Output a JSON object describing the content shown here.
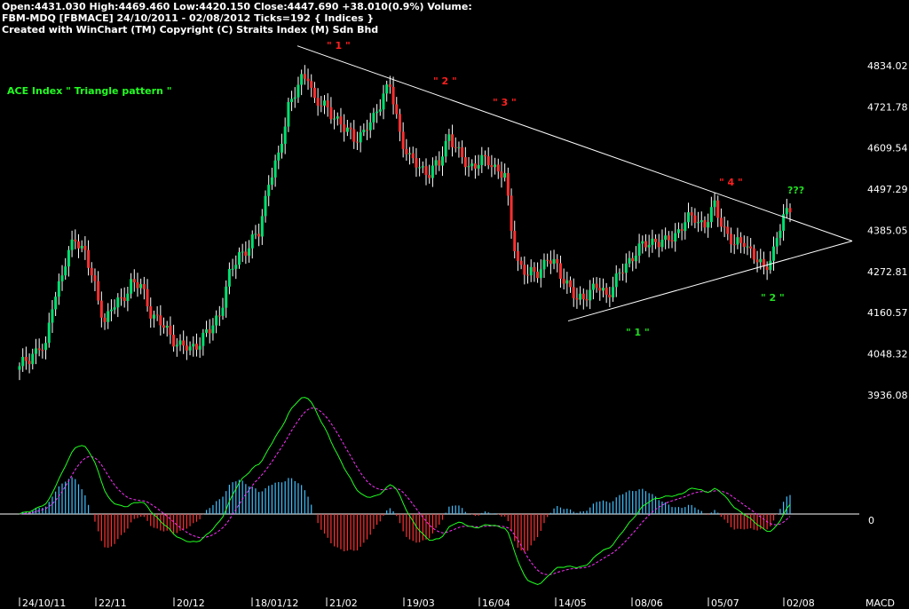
{
  "header": {
    "line1": "Open:4431.030  High:4469.460  Low:4420.150  Close:4447.690  +38.010(0.9%)  Volume:",
    "line2": "FBM-MDQ [FBMACE]  24/10/2011 - 02/08/2012  Ticks=192  { Indices }",
    "line3": "Created with WinChart (TM)  Copyright (C) Straits Index (M) Sdn Bhd"
  },
  "chart_data": {
    "type": "candlestick",
    "title": "ACE Index  \" Triangle pattern \"",
    "ylim": [
      3936.08,
      4834.02
    ],
    "y_ticks": [
      4834.02,
      4721.78,
      4609.54,
      4497.29,
      4385.05,
      4272.81,
      4160.57,
      4048.32,
      3936.08
    ],
    "x_ticks": [
      "24/10/11",
      "22/11",
      "20/12",
      "18/01/12",
      "21/02",
      "19/03",
      "16/04",
      "14/05",
      "08/06",
      "05/07",
      "02/08"
    ],
    "close_path": [
      [
        0,
        4015
      ],
      [
        3,
        4030
      ],
      [
        6,
        4075
      ],
      [
        8,
        4060
      ],
      [
        10,
        4180
      ],
      [
        14,
        4300
      ],
      [
        17,
        4360
      ],
      [
        20,
        4330
      ],
      [
        24,
        4190
      ],
      [
        26,
        4140
      ],
      [
        28,
        4175
      ],
      [
        31,
        4190
      ],
      [
        34,
        4245
      ],
      [
        37,
        4230
      ],
      [
        40,
        4165
      ],
      [
        43,
        4130
      ],
      [
        46,
        4100
      ],
      [
        49,
        4070
      ],
      [
        52,
        4060
      ],
      [
        55,
        4085
      ],
      [
        58,
        4110
      ],
      [
        61,
        4160
      ],
      [
        64,
        4260
      ],
      [
        67,
        4320
      ],
      [
        70,
        4340
      ],
      [
        73,
        4380
      ],
      [
        76,
        4520
      ],
      [
        79,
        4580
      ],
      [
        82,
        4730
      ],
      [
        86,
        4790
      ],
      [
        88,
        4810
      ],
      [
        90,
        4740
      ],
      [
        93,
        4720
      ],
      [
        96,
        4700
      ],
      [
        99,
        4660
      ],
      [
        102,
        4640
      ],
      [
        105,
        4650
      ],
      [
        108,
        4690
      ],
      [
        111,
        4760
      ],
      [
        113,
        4775
      ],
      [
        116,
        4650
      ],
      [
        119,
        4580
      ],
      [
        122,
        4555
      ],
      [
        125,
        4545
      ],
      [
        128,
        4565
      ],
      [
        131,
        4650
      ],
      [
        134,
        4590
      ],
      [
        137,
        4560
      ],
      [
        140,
        4570
      ],
      [
        143,
        4575
      ],
      [
        146,
        4550
      ],
      [
        148,
        4530
      ],
      [
        150,
        4390
      ],
      [
        152,
        4300
      ],
      [
        155,
        4260
      ],
      [
        158,
        4275
      ],
      [
        161,
        4305
      ],
      [
        164,
        4285
      ],
      [
        167,
        4240
      ],
      [
        170,
        4190
      ],
      [
        173,
        4215
      ],
      [
        176,
        4230
      ],
      [
        179,
        4210
      ],
      [
        182,
        4250
      ],
      [
        185,
        4290
      ],
      [
        188,
        4330
      ],
      [
        191,
        4345
      ],
      [
        194,
        4360
      ],
      [
        197,
        4350
      ],
      [
        200,
        4375
      ],
      [
        203,
        4410
      ],
      [
        206,
        4420
      ],
      [
        209,
        4400
      ],
      [
        212,
        4450
      ],
      [
        215,
        4390
      ],
      [
        218,
        4340
      ],
      [
        221,
        4360
      ],
      [
        224,
        4310
      ],
      [
        227,
        4280
      ],
      [
        230,
        4330
      ],
      [
        233,
        4420
      ],
      [
        235,
        4448
      ]
    ],
    "triangle": {
      "upper_line": [
        [
          0,
          4888
        ],
        [
          1.0,
          4356
        ]
      ],
      "lower_line": [
        [
          0,
          4138
        ],
        [
          1.0,
          4356
        ]
      ]
    },
    "annotations": [
      {
        "text": "\" 1 \"",
        "color": "#ff2020"
      },
      {
        "text": "\" 2 \"",
        "color": "#ff2020"
      },
      {
        "text": "\" 3 \"",
        "color": "#ff2020"
      },
      {
        "text": "\" 4 \"",
        "color": "#ff2020"
      },
      {
        "text": "???",
        "color": "#22dd22"
      },
      {
        "text": "\" 1 \"",
        "color": "#22dd22"
      },
      {
        "text": "\" 2 \"",
        "color": "#22dd22"
      }
    ],
    "macd": {
      "label": "MACD",
      "zero_label": "0"
    },
    "colors": {
      "up": "#00e070",
      "down": "#ff3030",
      "signal": "#ff30ff",
      "macd_line": "#20ff20",
      "hist_up": "#40c0ff",
      "hist_down": "#ff3030"
    }
  }
}
